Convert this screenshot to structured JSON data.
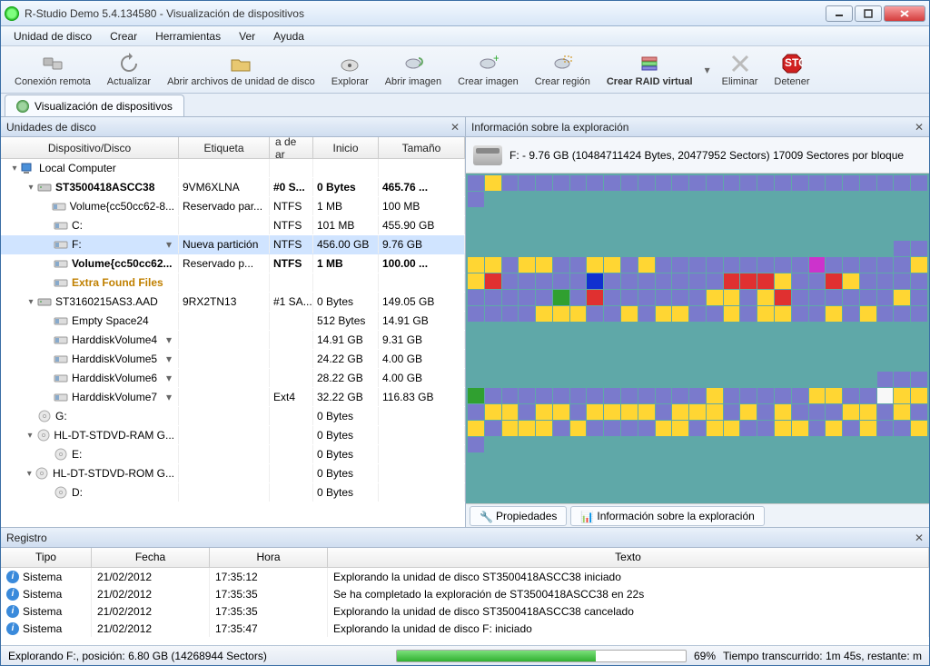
{
  "window": {
    "title": "R-Studio Demo 5.4.134580 - Visualización de dispositivos"
  },
  "menubar": [
    "Unidad de disco",
    "Crear",
    "Herramientas",
    "Ver",
    "Ayuda"
  ],
  "toolbar": [
    {
      "id": "conexion-remota",
      "label": "Conexión remota"
    },
    {
      "id": "actualizar",
      "label": "Actualizar"
    },
    {
      "id": "abrir-archivos",
      "label": "Abrir archivos de unidad de disco"
    },
    {
      "id": "explorar",
      "label": "Explorar"
    },
    {
      "id": "abrir-imagen",
      "label": "Abrir imagen"
    },
    {
      "id": "crear-imagen",
      "label": "Crear imagen"
    },
    {
      "id": "crear-region",
      "label": "Crear región"
    },
    {
      "id": "crear-raid",
      "label": "Crear RAID virtual"
    },
    {
      "id": "eliminar",
      "label": "Eliminar"
    },
    {
      "id": "detener",
      "label": "Detener"
    }
  ],
  "main_tab": "Visualización de dispositivos",
  "left": {
    "title": "Unidades de disco",
    "columns": [
      "Dispositivo/Disco",
      "Etiqueta",
      "a de ar",
      "Inicio",
      "Tamaño"
    ],
    "rows": [
      {
        "indent": 0,
        "exp": "▾",
        "icon": "computer",
        "disp": "Local Computer",
        "et": "",
        "ar": "",
        "in": "",
        "ta": "",
        "bold": false
      },
      {
        "indent": 1,
        "exp": "▾",
        "icon": "hdd",
        "disp": "ST3500418ASCC38",
        "et": "9VM6XLNA",
        "ar": "#0 S...",
        "in": "0 Bytes",
        "ta": "465.76 ...",
        "bold": true
      },
      {
        "indent": 2,
        "exp": "",
        "icon": "vol",
        "disp": "Volume{cc50cc62-8...",
        "et": "Reservado par...",
        "ar": "NTFS",
        "in": "1 MB",
        "ta": "100 MB"
      },
      {
        "indent": 2,
        "exp": "",
        "icon": "vol",
        "disp": "C:",
        "et": "",
        "ar": "NTFS",
        "in": "101 MB",
        "ta": "455.90 GB"
      },
      {
        "indent": 2,
        "exp": "",
        "icon": "vol",
        "disp": "F:",
        "et": "Nueva partición",
        "ar": "NTFS",
        "in": "456.00 GB",
        "ta": "9.76 GB",
        "selected": true,
        "drop": "▾"
      },
      {
        "indent": 2,
        "exp": "",
        "icon": "vol",
        "disp": "Volume{cc50cc62...",
        "et": "Reservado p...",
        "ar": "NTFS",
        "in": "1 MB",
        "ta": "100.00 ...",
        "bold": true
      },
      {
        "indent": 2,
        "exp": "",
        "icon": "vol",
        "disp": "Extra Found Files",
        "et": "",
        "ar": "",
        "in": "",
        "ta": "",
        "extra": true
      },
      {
        "indent": 1,
        "exp": "▾",
        "icon": "hdd",
        "disp": "ST3160215AS3.AAD",
        "et": "9RX2TN13",
        "ar": "#1 SA...",
        "in": "0 Bytes",
        "ta": "149.05 GB"
      },
      {
        "indent": 2,
        "exp": "",
        "icon": "vol",
        "disp": "Empty Space24",
        "et": "",
        "ar": "",
        "in": "512 Bytes",
        "ta": "14.91 GB"
      },
      {
        "indent": 2,
        "exp": "",
        "icon": "vol",
        "disp": "HarddiskVolume4",
        "et": "",
        "ar": "",
        "in": "14.91 GB",
        "ta": "9.31 GB",
        "drop": "▾"
      },
      {
        "indent": 2,
        "exp": "",
        "icon": "vol",
        "disp": "HarddiskVolume5",
        "et": "",
        "ar": "",
        "in": "24.22 GB",
        "ta": "4.00 GB",
        "drop": "▾"
      },
      {
        "indent": 2,
        "exp": "",
        "icon": "vol",
        "disp": "HarddiskVolume6",
        "et": "",
        "ar": "",
        "in": "28.22 GB",
        "ta": "4.00 GB",
        "drop": "▾"
      },
      {
        "indent": 2,
        "exp": "",
        "icon": "vol",
        "disp": "HarddiskVolume7",
        "et": "",
        "ar": "Ext4",
        "in": "32.22 GB",
        "ta": "116.83 GB",
        "drop": "▾"
      },
      {
        "indent": 1,
        "exp": "",
        "icon": "cd",
        "disp": "G:",
        "et": "",
        "ar": "",
        "in": "0 Bytes",
        "ta": ""
      },
      {
        "indent": 1,
        "exp": "▾",
        "icon": "cd",
        "disp": "HL-DT-STDVD-RAM G...",
        "et": "",
        "ar": "",
        "in": "0 Bytes",
        "ta": ""
      },
      {
        "indent": 2,
        "exp": "",
        "icon": "cd",
        "disp": "E:",
        "et": "",
        "ar": "",
        "in": "0 Bytes",
        "ta": ""
      },
      {
        "indent": 1,
        "exp": "▾",
        "icon": "cd",
        "disp": "HL-DT-STDVD-ROM G...",
        "et": "",
        "ar": "",
        "in": "0 Bytes",
        "ta": ""
      },
      {
        "indent": 2,
        "exp": "",
        "icon": "cd",
        "disp": "D:",
        "et": "",
        "ar": "",
        "in": "0 Bytes",
        "ta": ""
      }
    ]
  },
  "right": {
    "title": "Información sobre la exploración",
    "info": "F: - 9.76 GB (10484711424 Bytes, 20477952 Sectors) 17009 Sectores por bloque",
    "bottom_tabs": [
      "Propiedades",
      "Información sobre la exploración"
    ],
    "scanmap_pattern": "pypppppppppppppppppppppppppp_________________________________________________________________________________________________________ppyypyyppyypypppppppppmpppppyyrpppppbppppppprrrypprypppppppppgprppppppyypyrppppppypppppyyyppypyyppypyyppypyppp_________________________________________________________________________________________________________pppgpppppppppppppypppppyyppwyypyypyypyyyypyyypypypppyypypypyyypyppppyypyyppyypypyppyp__________________________________________________________________________________________________________________________________________________________________________________________________________________________________________________________________________________________________________________________"
  },
  "log": {
    "title": "Registro",
    "columns": [
      "Tipo",
      "Fecha",
      "Hora",
      "Texto"
    ],
    "rows": [
      {
        "tipo": "Sistema",
        "fecha": "21/02/2012",
        "hora": "17:35:12",
        "texto": "Explorando la unidad de disco ST3500418ASCC38 iniciado"
      },
      {
        "tipo": "Sistema",
        "fecha": "21/02/2012",
        "hora": "17:35:35",
        "texto": "Se ha completado la exploración de ST3500418ASCC38 en 22s"
      },
      {
        "tipo": "Sistema",
        "fecha": "21/02/2012",
        "hora": "17:35:35",
        "texto": "Explorando la unidad de disco ST3500418ASCC38 cancelado"
      },
      {
        "tipo": "Sistema",
        "fecha": "21/02/2012",
        "hora": "17:35:47",
        "texto": "Explorando la unidad de disco F: iniciado"
      }
    ]
  },
  "status": {
    "left": "Explorando F:, posición: 6.80 GB (14268944 Sectors)",
    "percent_text": "69%",
    "percent": 69,
    "right": "Tiempo transcurrido: 1m 45s, restante: m"
  }
}
